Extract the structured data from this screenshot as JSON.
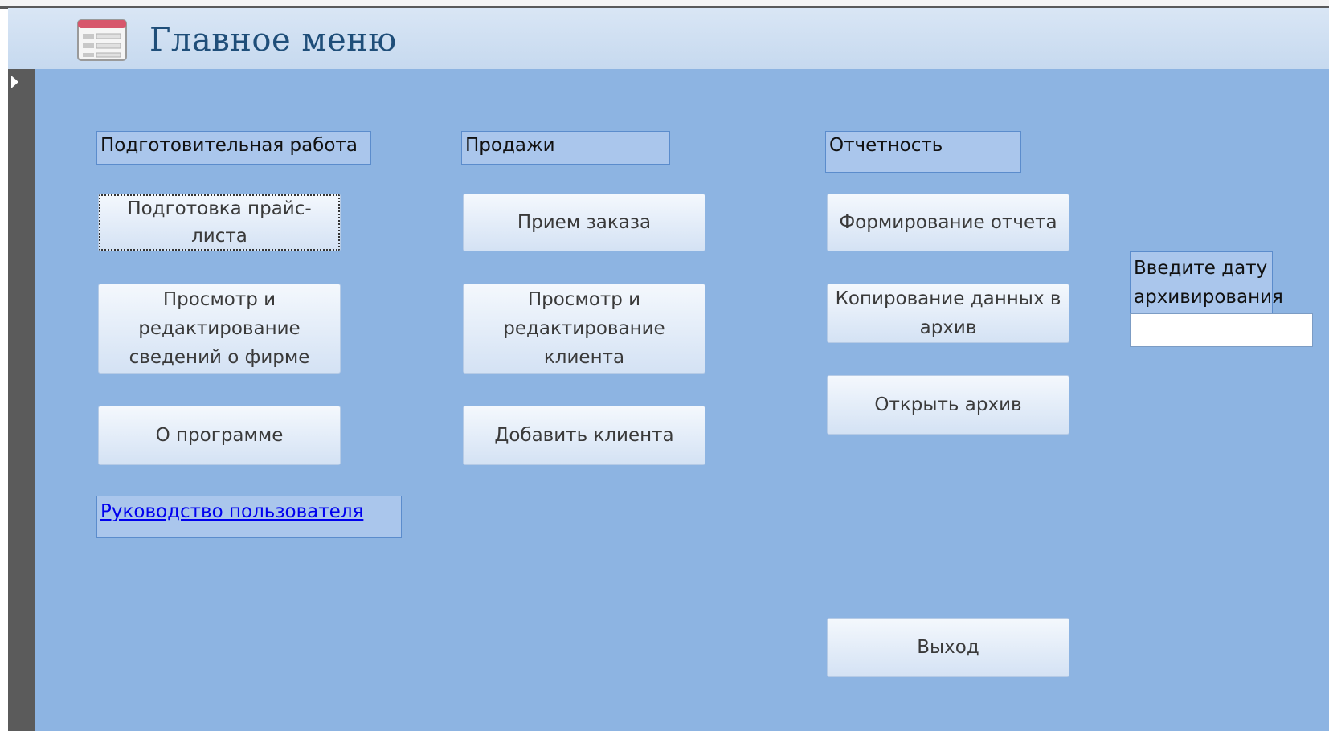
{
  "form": {
    "title": "Главное меню",
    "icon": "form-icon"
  },
  "sections": {
    "preparation": {
      "label": "Подготовительная работа"
    },
    "sales": {
      "label": "Продажи"
    },
    "reporting": {
      "label": "Отчетность"
    }
  },
  "buttons": {
    "price_list": "Подготовка прайс-листа",
    "firm_info": "Просмотр и редактирование сведений о фирме",
    "about": "О программе",
    "order": "Прием заказа",
    "client_edit": "Просмотр и редактирование клиента",
    "add_client": "Добавить клиента",
    "report": "Формирование отчета",
    "copy_archive": "Копирование данных в архив",
    "open_archive": "Открыть архив",
    "exit": "Выход"
  },
  "links": {
    "user_guide": "Руководство пользователя"
  },
  "archive_date": {
    "label": "Введите дату архивирования",
    "value": ""
  },
  "colors": {
    "background": "#8db4e2",
    "header": "#c6d9ef",
    "title": "#1f4e79",
    "link": "#0000ee"
  }
}
